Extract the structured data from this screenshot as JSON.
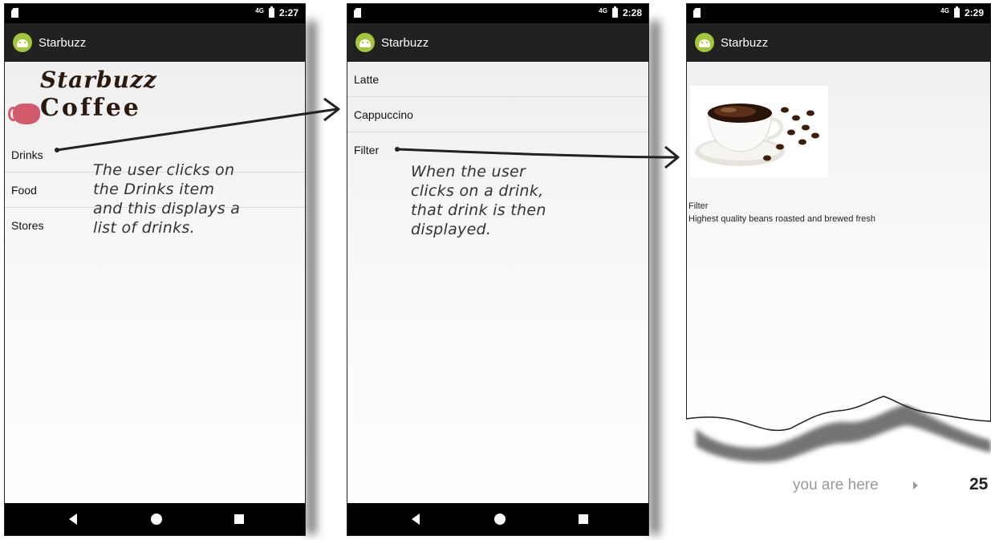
{
  "screen1": {
    "status_time": "2:27",
    "signal": "4G",
    "app_title": "Starbuzz",
    "logo_line1": "Starbuzz",
    "logo_line2": "Coffee",
    "items": [
      "Drinks",
      "Food",
      "Stores"
    ]
  },
  "screen2": {
    "status_time": "2:28",
    "signal": "4G",
    "app_title": "Starbuzz",
    "items": [
      "Latte",
      "Cappuccino",
      "Filter"
    ]
  },
  "screen3": {
    "status_time": "2:29",
    "signal": "4G",
    "app_title": "Starbuzz",
    "drink_name": "Filter",
    "drink_description": "Highest quality beans roasted and brewed fresh"
  },
  "annotations": {
    "note1": "The user clicks on\nthe Drinks item\nand this displays a\nlist of drinks.",
    "note2": "When the user\nclicks on a drink,\nthat drink is then\ndisplayed."
  },
  "footer": {
    "you_are_here": "you are here",
    "page_number": "25"
  },
  "icons": {
    "app_icon": "android-icon",
    "nav_back": "back-icon",
    "nav_home": "home-icon",
    "nav_recent": "recent-apps-icon"
  },
  "colors": {
    "status_bar": "#000000",
    "app_bar": "#212121",
    "android_green": "#a4c639"
  }
}
